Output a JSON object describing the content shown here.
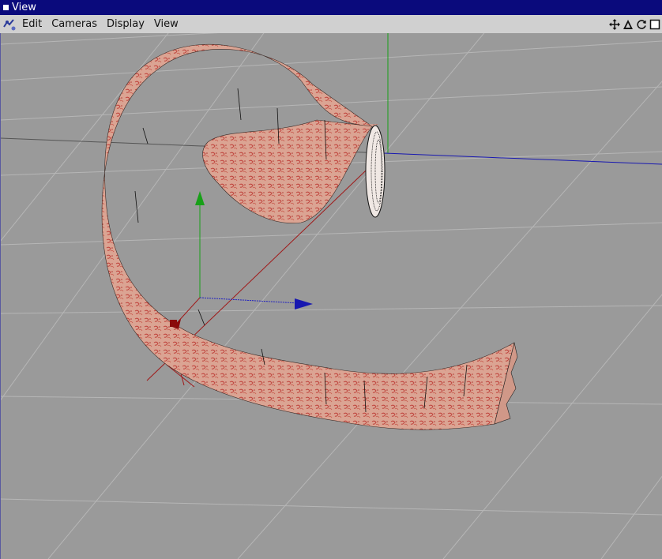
{
  "window": {
    "title": "View"
  },
  "menu": {
    "items": [
      {
        "label": "Edit"
      },
      {
        "label": "Cameras"
      },
      {
        "label": "Display"
      },
      {
        "label": "View"
      }
    ]
  },
  "toolbar": {
    "icons": [
      "move-icon",
      "rotate-icon",
      "refresh-icon",
      "maximize-icon"
    ]
  },
  "colors": {
    "titlebar": "#0a0a7c",
    "menubar": "#d0d0d0",
    "viewport_bg": "#9a9a9a",
    "grid_line": "#b4b4b4",
    "axis_x": "#a01818",
    "axis_y": "#18a018",
    "axis_z": "#1818b0",
    "tube_skin": "#d9a08e"
  }
}
